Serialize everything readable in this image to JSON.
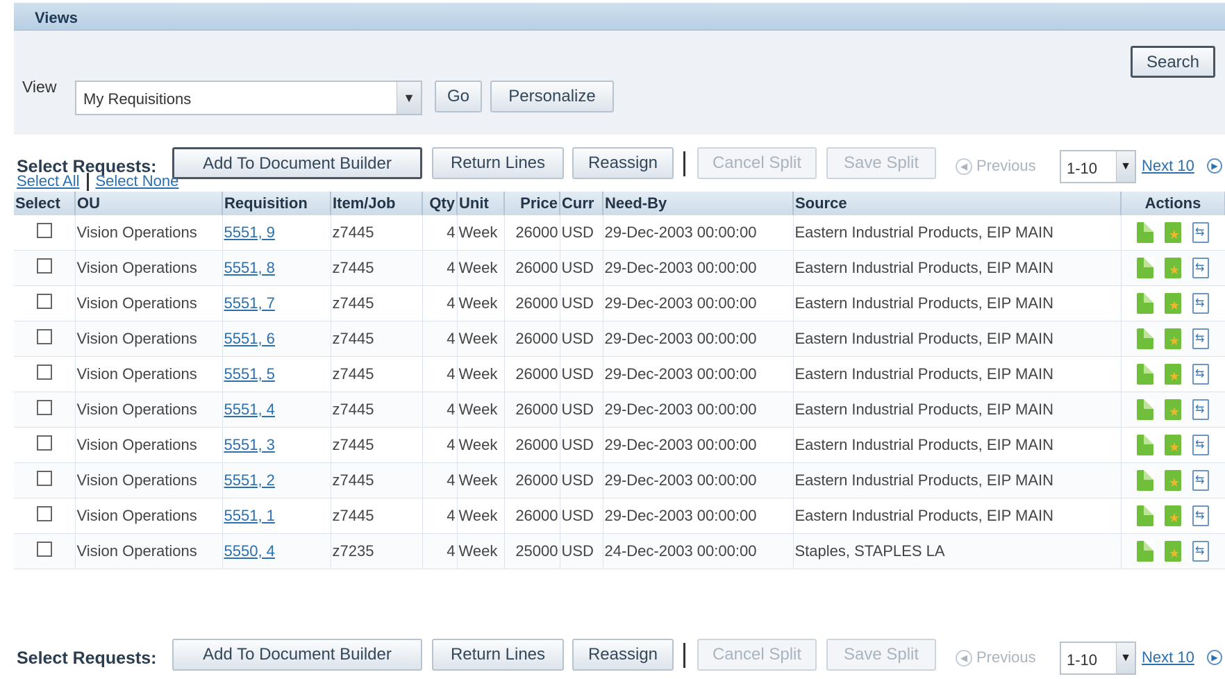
{
  "views_header": "Views",
  "search_button": "Search",
  "view_label": "View",
  "view_select_value": "My Requisitions",
  "go_button": "Go",
  "personalize_button": "Personalize",
  "toolbar": {
    "label": "Select Requests:",
    "add_to_doc_builder": "Add To Document Builder",
    "return_lines": "Return Lines",
    "reassign": "Reassign",
    "cancel_split": "Cancel Split",
    "save_split": "Save Split",
    "previous": "Previous",
    "range": "1-10",
    "next": "Next 10"
  },
  "select_all": "Select All",
  "select_none": "Select None",
  "columns": [
    "Select",
    "OU",
    "Requisition",
    "Item/Job",
    "Qty",
    "Unit",
    "Price",
    "Curr",
    "Need-By",
    "Source",
    "Actions"
  ],
  "rows": [
    {
      "ou": "Vision Operations",
      "req": "5551, 9",
      "item": "z7445",
      "qty": "4",
      "unit": "Week",
      "price": "26000",
      "curr": "USD",
      "needby": "29-Dec-2003 00:00:00",
      "source": "Eastern Industrial Products, EIP MAIN"
    },
    {
      "ou": "Vision Operations",
      "req": "5551, 8",
      "item": "z7445",
      "qty": "4",
      "unit": "Week",
      "price": "26000",
      "curr": "USD",
      "needby": "29-Dec-2003 00:00:00",
      "source": "Eastern Industrial Products, EIP MAIN"
    },
    {
      "ou": "Vision Operations",
      "req": "5551, 7",
      "item": "z7445",
      "qty": "4",
      "unit": "Week",
      "price": "26000",
      "curr": "USD",
      "needby": "29-Dec-2003 00:00:00",
      "source": "Eastern Industrial Products, EIP MAIN"
    },
    {
      "ou": "Vision Operations",
      "req": "5551, 6",
      "item": "z7445",
      "qty": "4",
      "unit": "Week",
      "price": "26000",
      "curr": "USD",
      "needby": "29-Dec-2003 00:00:00",
      "source": "Eastern Industrial Products, EIP MAIN"
    },
    {
      "ou": "Vision Operations",
      "req": "5551, 5",
      "item": "z7445",
      "qty": "4",
      "unit": "Week",
      "price": "26000",
      "curr": "USD",
      "needby": "29-Dec-2003 00:00:00",
      "source": "Eastern Industrial Products, EIP MAIN"
    },
    {
      "ou": "Vision Operations",
      "req": "5551, 4",
      "item": "z7445",
      "qty": "4",
      "unit": "Week",
      "price": "26000",
      "curr": "USD",
      "needby": "29-Dec-2003 00:00:00",
      "source": "Eastern Industrial Products, EIP MAIN"
    },
    {
      "ou": "Vision Operations",
      "req": "5551, 3",
      "item": "z7445",
      "qty": "4",
      "unit": "Week",
      "price": "26000",
      "curr": "USD",
      "needby": "29-Dec-2003 00:00:00",
      "source": "Eastern Industrial Products, EIP MAIN"
    },
    {
      "ou": "Vision Operations",
      "req": "5551, 2",
      "item": "z7445",
      "qty": "4",
      "unit": "Week",
      "price": "26000",
      "curr": "USD",
      "needby": "29-Dec-2003 00:00:00",
      "source": "Eastern Industrial Products, EIP MAIN"
    },
    {
      "ou": "Vision Operations",
      "req": "5551, 1",
      "item": "z7445",
      "qty": "4",
      "unit": "Week",
      "price": "26000",
      "curr": "USD",
      "needby": "29-Dec-2003 00:00:00",
      "source": "Eastern Industrial Products, EIP MAIN"
    },
    {
      "ou": "Vision Operations",
      "req": "5550, 4",
      "item": "z7235",
      "qty": "4",
      "unit": "Week",
      "price": "25000",
      "curr": "USD",
      "needby": "24-Dec-2003 00:00:00",
      "source": "Staples, STAPLES LA"
    }
  ],
  "action_icons": [
    "document-icon",
    "favorite-document-icon",
    "split-icon"
  ]
}
